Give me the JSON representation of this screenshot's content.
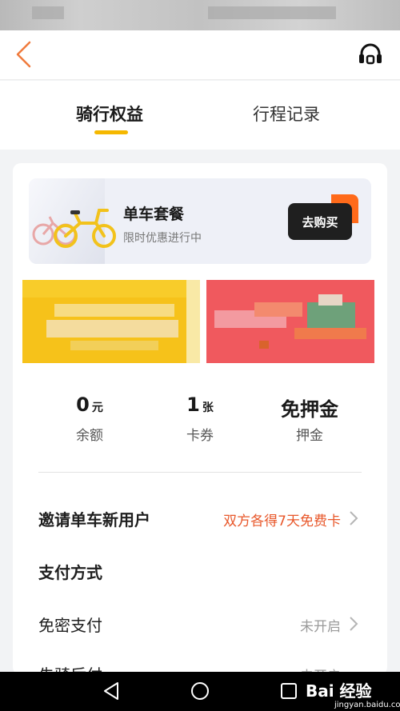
{
  "tabs": {
    "riding_benefits": "骑行权益",
    "trip_records": "行程记录"
  },
  "promo": {
    "title": "单车套餐",
    "subtitle": "限时优惠进行中",
    "buy_label": "去购买"
  },
  "stats": {
    "balance": {
      "value": "0",
      "unit": "元",
      "label": "余额"
    },
    "coupons": {
      "value": "1",
      "unit": "张",
      "label": "卡券"
    },
    "deposit": {
      "value": "免押金",
      "label": "押金"
    }
  },
  "rows": {
    "invite": {
      "label": "邀请单车新用户",
      "value": "双方各得7天免费卡"
    },
    "payment_header": {
      "label": "支付方式"
    },
    "password_free": {
      "label": "免密支付",
      "value": "未开启"
    },
    "next": {
      "label": "先骑后付",
      "value": "未开启"
    }
  },
  "watermark": {
    "text": "Bai 经验",
    "url": "jingyan.baidu.com"
  },
  "colors": {
    "accent_yellow": "#f5b800",
    "accent_orange": "#e8572a",
    "dark_button": "#1f1f1f"
  }
}
